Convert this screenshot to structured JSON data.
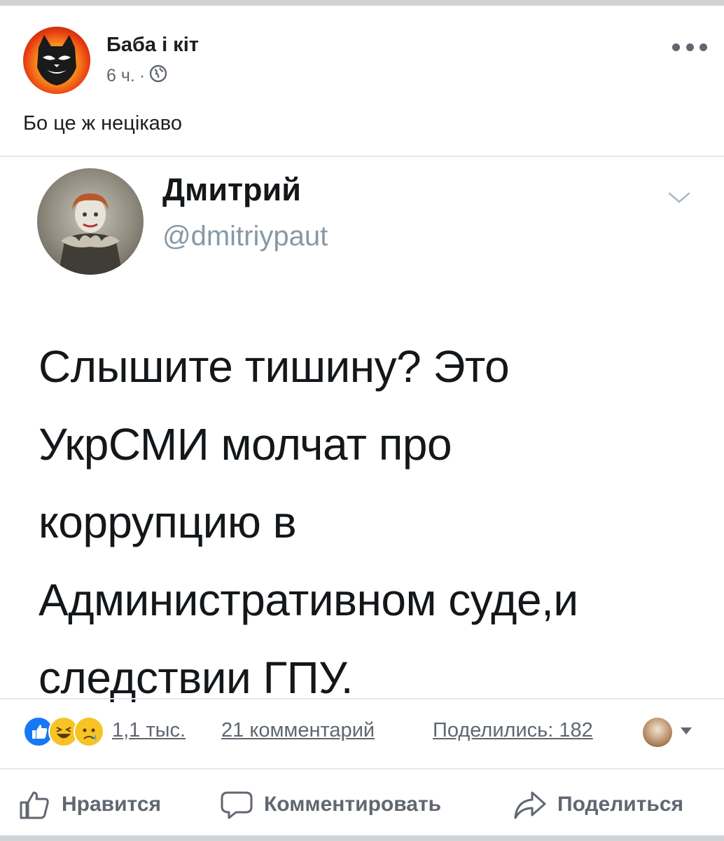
{
  "post": {
    "author": "Баба і кіт",
    "time": "6 ч.",
    "separator": "·",
    "text": "Бо це ж нецікаво"
  },
  "tweet": {
    "name": "Дмитрий",
    "handle": "@dmitriypaut",
    "body": "Слышите тишину? Это\nУкрСМИ молчат про\nкоррупцию в\nАдминистративном суде,и\nследствии ГПУ."
  },
  "stats": {
    "reactions": "1,1 тыс.",
    "comments": "21 комментарий",
    "shares": "Поделились: 182"
  },
  "actions": {
    "like": "Нравится",
    "comment": "Комментировать",
    "share": "Поделиться"
  },
  "colors": {
    "like_blue": "#1877f2",
    "emoji_yellow": "#f7c325",
    "secondary_text": "#606770",
    "handle_gray": "#8899a6"
  },
  "icons": {
    "more": "more-horizontal-icon",
    "privacy": "globe-icon",
    "tweet_menu": "chevron-down-icon",
    "like": "thumbs-up-icon",
    "comment": "speech-bubble-icon",
    "share": "share-arrow-icon"
  }
}
